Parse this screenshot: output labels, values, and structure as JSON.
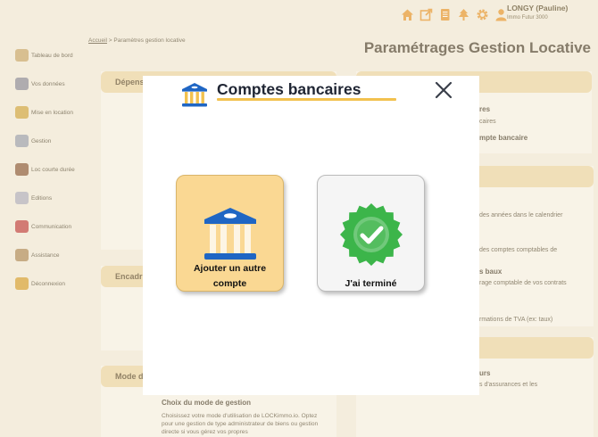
{
  "user": {
    "name": "LONGY (Pauline)",
    "org": "Immo Futur 3000"
  },
  "top_icons": [
    "home-icon",
    "external-link-icon",
    "document-icon",
    "tree-icon",
    "gear-icon",
    "user-icon"
  ],
  "breadcrumb": {
    "home": "Accueil",
    "separator": ">",
    "current": "Paramètres gestion locative"
  },
  "page_title": "Paramétrages Gestion Locative",
  "sidebar": {
    "items": [
      {
        "label": "Tableau de bord",
        "icon": "dashboard-icon",
        "color": "#c9a86a"
      },
      {
        "label": "Vos données",
        "icon": "person-icon",
        "color": "#8a8a9a"
      },
      {
        "label": "Mise en location",
        "icon": "keys-icon",
        "color": "#d2a640"
      },
      {
        "label": "Gestion",
        "icon": "management-icon",
        "color": "#9aa0b0"
      },
      {
        "label": "Loc courte durée",
        "icon": "suitcase-icon",
        "color": "#8a5a3a"
      },
      {
        "label": "Editions",
        "icon": "editions-icon",
        "color": "#b0b0c0"
      },
      {
        "label": "Communication",
        "icon": "communication-icon",
        "color": "#c04040"
      },
      {
        "label": "Assistance",
        "icon": "assistance-icon",
        "color": "#b08a5a"
      },
      {
        "label": "Déconnexion",
        "icon": "logout-icon",
        "color": "#d8a030"
      }
    ]
  },
  "background": {
    "left_cards": [
      {
        "head": "Dépens"
      },
      {
        "head": "Encadr"
      },
      {
        "head": "Mode d"
      }
    ],
    "right_texts": {
      "t1": "res",
      "t2": "caires",
      "t3": "mpte bancaire",
      "t4": "des années dans le calendrier",
      "t5": "des comptes comptables de",
      "t6": "s baux",
      "t7": "rage comptable de vos contrats",
      "t8": "rmations de TVA (ex: taux)",
      "t9": "urs",
      "t10": "s d'assurances et les"
    },
    "mode_gestion": {
      "title": "Choix du mode de gestion",
      "text": "Choisissez votre mode d'utilisation de LOCKimmo.io. Optez pour une gestion de type administrateur de biens ou gestion directe si vous gérez vos propres"
    }
  },
  "modal": {
    "title": "Comptes bancaires",
    "icon": "bank-icon",
    "close_icon": "close-icon",
    "colors": {
      "accent": "#f2c14e",
      "bank_blue": "#1f66c4",
      "check_green": "#3cb54a"
    },
    "options": [
      {
        "label": "Ajouter un autre compte",
        "icon": "bank-icon"
      },
      {
        "label": "J'ai terminé",
        "icon": "checkmark-badge-icon"
      }
    ]
  }
}
